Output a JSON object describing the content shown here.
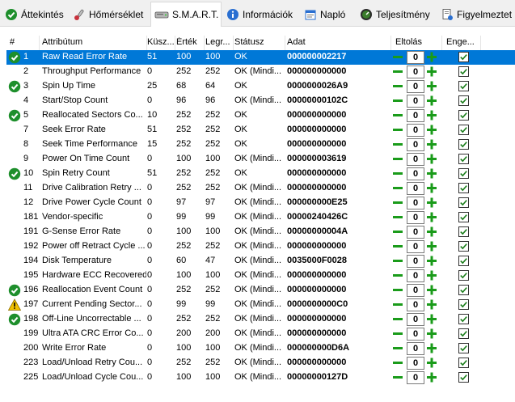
{
  "tabs": [
    {
      "label": "Áttekintés",
      "icon": "overview-check-icon",
      "active": false
    },
    {
      "label": "Hőmérséklet",
      "icon": "thermometer-icon",
      "active": false
    },
    {
      "label": "S.M.A.R.T.",
      "icon": "drive-icon",
      "active": true
    },
    {
      "label": "Információk",
      "icon": "info-icon",
      "active": false
    },
    {
      "label": "Napló",
      "icon": "log-icon",
      "active": false
    },
    {
      "label": "Teljesítmény",
      "icon": "performance-gauge-icon",
      "active": false
    },
    {
      "label": "Figyelmeztet",
      "icon": "alert-document-icon",
      "active": false
    }
  ],
  "table": {
    "headers": {
      "num": "#",
      "attribute": "Attribútum",
      "threshold": "Küsz...",
      "value": "Érték",
      "worst": "Legr...",
      "status": "Státusz",
      "data": "Adat",
      "offset": "Eltolás",
      "enabled": "Enge..."
    },
    "rows": [
      {
        "icon": "ok",
        "num": "1",
        "attribute": "Raw Read Error Rate",
        "threshold": "51",
        "value": "100",
        "worst": "100",
        "status": "OK",
        "data": "000000002217",
        "offset": "0",
        "enabled": true,
        "selected": true
      },
      {
        "icon": "",
        "num": "2",
        "attribute": "Throughput Performance",
        "threshold": "0",
        "value": "252",
        "worst": "252",
        "status": "OK (Mindi...",
        "data": "000000000000",
        "offset": "0",
        "enabled": true
      },
      {
        "icon": "ok",
        "num": "3",
        "attribute": "Spin Up Time",
        "threshold": "25",
        "value": "68",
        "worst": "64",
        "status": "OK",
        "data": "0000000026A9",
        "offset": "0",
        "enabled": true
      },
      {
        "icon": "",
        "num": "4",
        "attribute": "Start/Stop Count",
        "threshold": "0",
        "value": "96",
        "worst": "96",
        "status": "OK (Mindi...",
        "data": "00000000102C",
        "offset": "0",
        "enabled": true
      },
      {
        "icon": "ok",
        "num": "5",
        "attribute": "Reallocated Sectors Co...",
        "threshold": "10",
        "value": "252",
        "worst": "252",
        "status": "OK",
        "data": "000000000000",
        "offset": "0",
        "enabled": true
      },
      {
        "icon": "",
        "num": "7",
        "attribute": "Seek Error Rate",
        "threshold": "51",
        "value": "252",
        "worst": "252",
        "status": "OK",
        "data": "000000000000",
        "offset": "0",
        "enabled": true
      },
      {
        "icon": "",
        "num": "8",
        "attribute": "Seek Time Performance",
        "threshold": "15",
        "value": "252",
        "worst": "252",
        "status": "OK",
        "data": "000000000000",
        "offset": "0",
        "enabled": true
      },
      {
        "icon": "",
        "num": "9",
        "attribute": "Power On Time Count",
        "threshold": "0",
        "value": "100",
        "worst": "100",
        "status": "OK (Mindi...",
        "data": "000000003619",
        "offset": "0",
        "enabled": true
      },
      {
        "icon": "ok",
        "num": "10",
        "attribute": "Spin Retry Count",
        "threshold": "51",
        "value": "252",
        "worst": "252",
        "status": "OK",
        "data": "000000000000",
        "offset": "0",
        "enabled": true
      },
      {
        "icon": "",
        "num": "11",
        "attribute": "Drive Calibration Retry ...",
        "threshold": "0",
        "value": "252",
        "worst": "252",
        "status": "OK (Mindi...",
        "data": "000000000000",
        "offset": "0",
        "enabled": true
      },
      {
        "icon": "",
        "num": "12",
        "attribute": "Drive Power Cycle Count",
        "threshold": "0",
        "value": "97",
        "worst": "97",
        "status": "OK (Mindi...",
        "data": "000000000E25",
        "offset": "0",
        "enabled": true
      },
      {
        "icon": "",
        "num": "181",
        "attribute": "Vendor-specific",
        "threshold": "0",
        "value": "99",
        "worst": "99",
        "status": "OK (Mindi...",
        "data": "00000240426C",
        "offset": "0",
        "enabled": true
      },
      {
        "icon": "",
        "num": "191",
        "attribute": "G-Sense Error Rate",
        "threshold": "0",
        "value": "100",
        "worst": "100",
        "status": "OK (Mindi...",
        "data": "00000000004A",
        "offset": "0",
        "enabled": true
      },
      {
        "icon": "",
        "num": "192",
        "attribute": "Power off Retract Cycle ...",
        "threshold": "0",
        "value": "252",
        "worst": "252",
        "status": "OK (Mindi...",
        "data": "000000000000",
        "offset": "0",
        "enabled": true
      },
      {
        "icon": "",
        "num": "194",
        "attribute": "Disk Temperature",
        "threshold": "0",
        "value": "60",
        "worst": "47",
        "status": "OK (Mindi...",
        "data": "0035000F0028",
        "offset": "0",
        "enabled": true
      },
      {
        "icon": "",
        "num": "195",
        "attribute": "Hardware ECC Recovered",
        "threshold": "0",
        "value": "100",
        "worst": "100",
        "status": "OK (Mindi...",
        "data": "000000000000",
        "offset": "0",
        "enabled": true
      },
      {
        "icon": "ok",
        "num": "196",
        "attribute": "Reallocation Event Count",
        "threshold": "0",
        "value": "252",
        "worst": "252",
        "status": "OK (Mindi...",
        "data": "000000000000",
        "offset": "0",
        "enabled": true
      },
      {
        "icon": "warn",
        "num": "197",
        "attribute": "Current Pending Sector...",
        "threshold": "0",
        "value": "99",
        "worst": "99",
        "status": "OK (Mindi...",
        "data": "0000000000C0",
        "offset": "0",
        "enabled": true
      },
      {
        "icon": "ok",
        "num": "198",
        "attribute": "Off-Line Uncorrectable ...",
        "threshold": "0",
        "value": "252",
        "worst": "252",
        "status": "OK (Mindi...",
        "data": "000000000000",
        "offset": "0",
        "enabled": true
      },
      {
        "icon": "",
        "num": "199",
        "attribute": "Ultra ATA CRC Error Co...",
        "threshold": "0",
        "value": "200",
        "worst": "200",
        "status": "OK (Mindi...",
        "data": "000000000000",
        "offset": "0",
        "enabled": true
      },
      {
        "icon": "",
        "num": "200",
        "attribute": "Write Error Rate",
        "threshold": "0",
        "value": "100",
        "worst": "100",
        "status": "OK (Mindi...",
        "data": "000000000D6A",
        "offset": "0",
        "enabled": true
      },
      {
        "icon": "",
        "num": "223",
        "attribute": "Load/Unload Retry Cou...",
        "threshold": "0",
        "value": "252",
        "worst": "252",
        "status": "OK (Mindi...",
        "data": "000000000000",
        "offset": "0",
        "enabled": true
      },
      {
        "icon": "",
        "num": "225",
        "attribute": "Load/Unload Cycle Cou...",
        "threshold": "0",
        "value": "100",
        "worst": "100",
        "status": "OK (Mindi...",
        "data": "00000000127D",
        "offset": "0",
        "enabled": true
      }
    ]
  },
  "colors": {
    "selection": "#0078d7",
    "ok_green": "#1e8f2c",
    "warn_yellow": "#f2c200",
    "adjust_green": "#1a9b1a"
  }
}
